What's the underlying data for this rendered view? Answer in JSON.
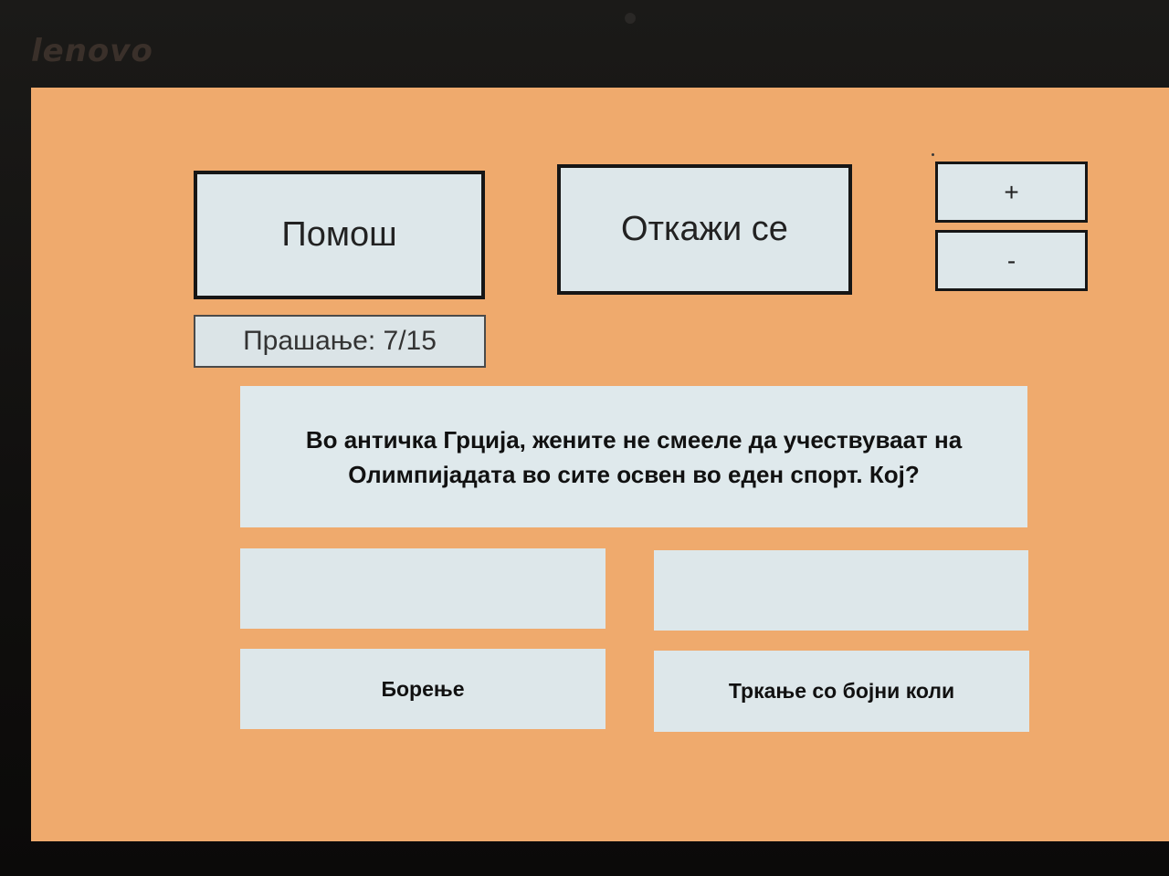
{
  "device": {
    "brand": "lenovo"
  },
  "controls": {
    "help_label": "Помош",
    "quit_label": "Откажи се",
    "zoom_in_label": "+",
    "zoom_out_label": "-"
  },
  "progress": {
    "text": "Прашање: 7/15",
    "current": 7,
    "total": 15
  },
  "question": {
    "line1": "Во античка Грција, жените не смееле да учествуваат на",
    "line2": "Олимпијадата во сите освен во еден спорт. Кој?"
  },
  "answers": [
    {
      "label": ""
    },
    {
      "label": ""
    },
    {
      "label": "Борење"
    },
    {
      "label": "Тркање со бојни коли"
    }
  ],
  "colors": {
    "screen_background": "#efaa6d",
    "panel": "#dde7ea",
    "border": "#161616"
  }
}
